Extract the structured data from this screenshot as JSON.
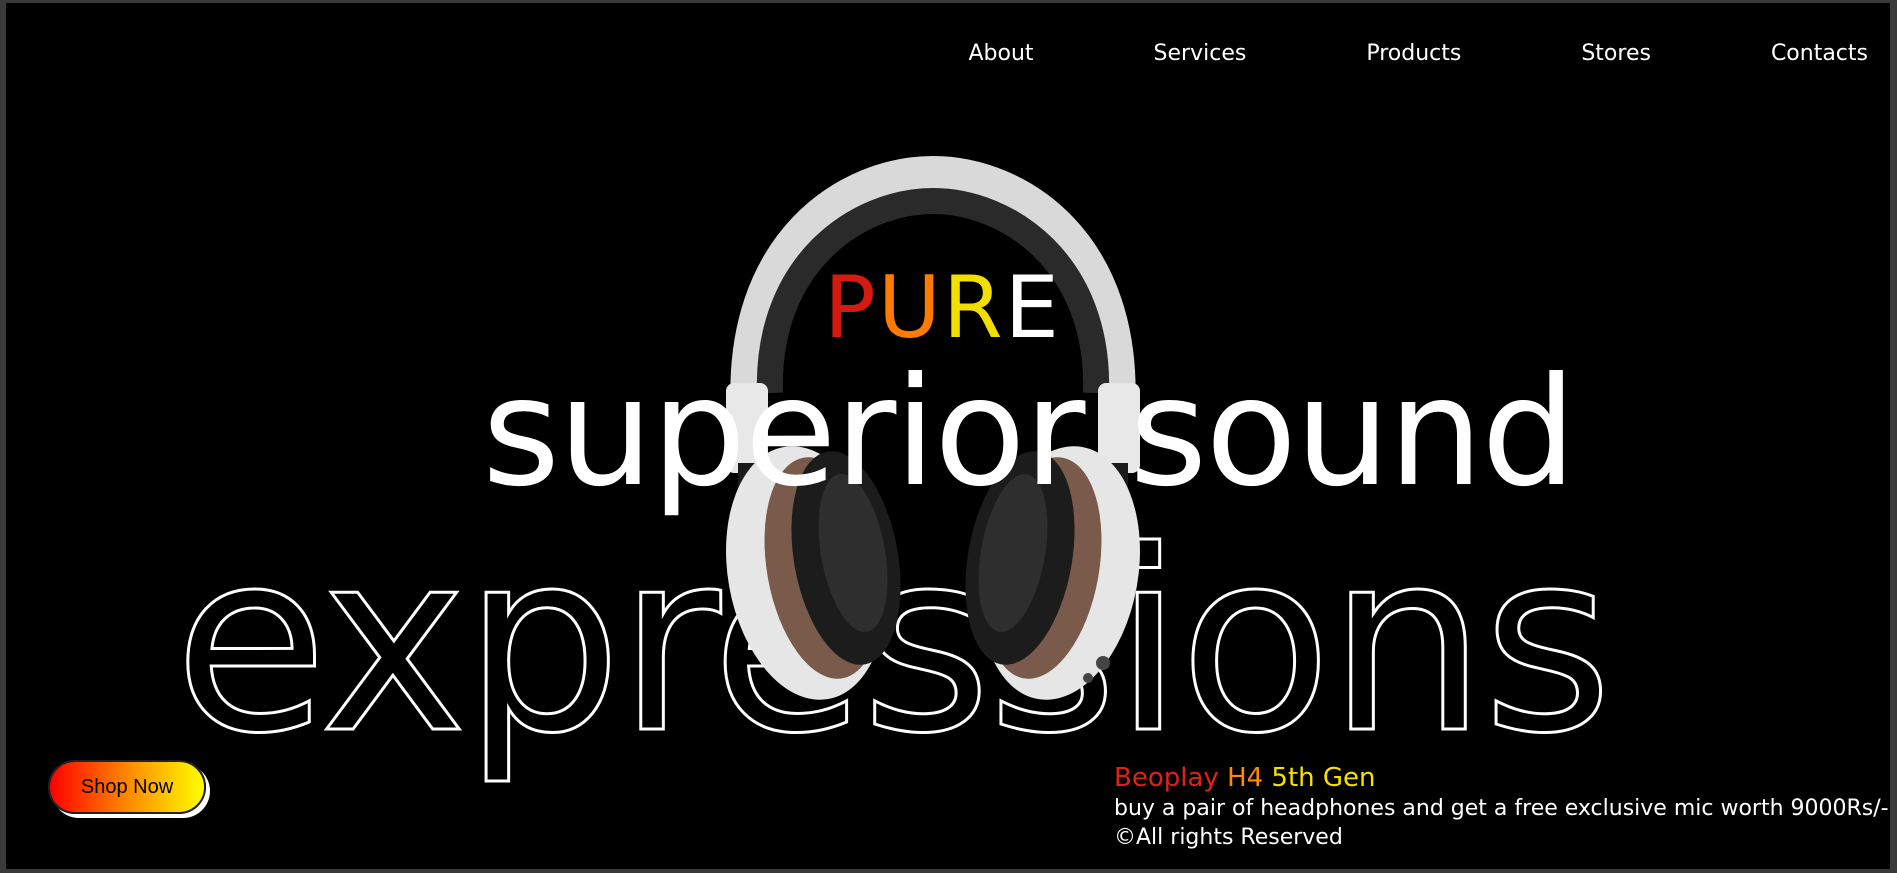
{
  "nav": {
    "items": [
      "About",
      "Services",
      "Products",
      "Stores",
      "Contacts"
    ]
  },
  "hero": {
    "pure_letters": [
      {
        "char": "P",
        "color": "#d51a12"
      },
      {
        "char": "U",
        "color": "#ff7a00"
      },
      {
        "char": "R",
        "color": "#f2de00"
      },
      {
        "char": "E",
        "color": "#ffffff"
      }
    ],
    "line2": "superior sound",
    "line3": "expressions"
  },
  "cta": {
    "shop_label": "Shop Now"
  },
  "promo": {
    "product_part1": "Beoplay ",
    "product_part2": "H4 ",
    "product_part3": "5th Gen",
    "offer": "buy a pair of headphones and get a free exclusive mic worth 9000Rs/-",
    "copyright": "©All rights Reserved"
  },
  "colors": {
    "background": "#000000",
    "text": "#ffffff",
    "accent_red": "#d51a12",
    "accent_orange": "#ff7a00",
    "accent_yellow": "#f2de00"
  }
}
